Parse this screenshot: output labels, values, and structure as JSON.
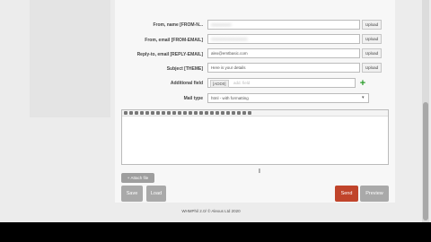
{
  "form": {
    "from_name_label": "From, name [FROM-N...",
    "from_email_label": "From, email [FROM-EMAIL]",
    "reply_to_label": "Reply-to, email [REPLY-EMAIL]",
    "reply_to_value": "alex@emtbasic.com",
    "subject_label": "Subject [THEME]",
    "subject_value": "Here is your details",
    "additional_label": "Additional field",
    "additional_chip": "[ADD0]",
    "additional_placeholder": "add. field",
    "mail_type_label": "Mail type",
    "mail_type_value": "html - with formatting",
    "upload_label": "Upload"
  },
  "buttons": {
    "attach": "Attach file",
    "save": "Save",
    "load": "Load",
    "send": "Send",
    "preview": "Preview"
  },
  "footer": {
    "text": "WHMPhil 2.0/ © Alexus Ltd 2020"
  }
}
